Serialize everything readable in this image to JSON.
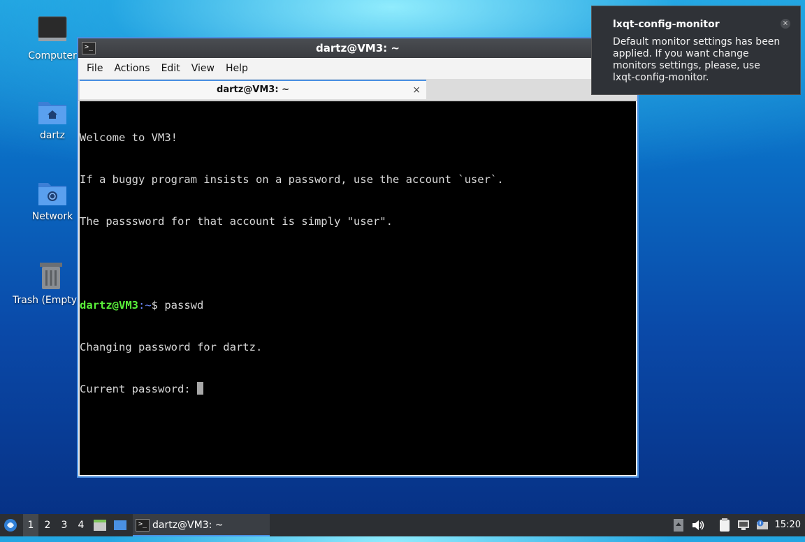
{
  "desktop": {
    "icons": [
      {
        "label": "Computer",
        "icon": "computer-icon"
      },
      {
        "label": "dartz",
        "icon": "home-folder-icon"
      },
      {
        "label": "Network",
        "icon": "network-folder-icon"
      },
      {
        "label": "Trash (Empty)",
        "icon": "trash-icon"
      }
    ]
  },
  "window": {
    "title": "dartz@VM3: ~",
    "menu": [
      "File",
      "Actions",
      "Edit",
      "View",
      "Help"
    ],
    "tab": {
      "label": "dartz@VM3: ~",
      "close": "×"
    },
    "terminal": {
      "lines": [
        "Welcome to VM3!",
        "If a buggy program insists on a password, use the account `user`.",
        "The passsword for that account is simply \"user\"."
      ],
      "prompt_user": "dartz@VM3",
      "prompt_path": ":~",
      "prompt_symbol": "$ ",
      "command": "passwd",
      "output": [
        "Changing password for dartz.",
        "Current password: "
      ]
    }
  },
  "notification": {
    "title": "lxqt-config-monitor",
    "body": "Default monitor settings has been applied. If you want change monitors settings, please, use lxqt-config-monitor.",
    "close": "×"
  },
  "taskbar": {
    "workspaces": [
      "1",
      "2",
      "3",
      "4"
    ],
    "active_workspace": "1",
    "task_label": "dartz@VM3: ~",
    "clock": "15:20",
    "colors": {
      "accent": "#4a90e2",
      "panel": "#2c2f33"
    }
  }
}
